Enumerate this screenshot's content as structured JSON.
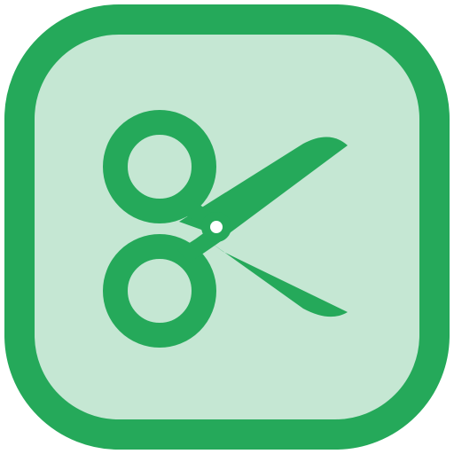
{
  "icon": {
    "name": "scissors-icon",
    "colors": {
      "border": "#25A95A",
      "fill": "#C5E7D3",
      "glyph": "#25A95A",
      "pivot_dot": "#FFFFFF",
      "background": "#FFFFFF"
    }
  }
}
